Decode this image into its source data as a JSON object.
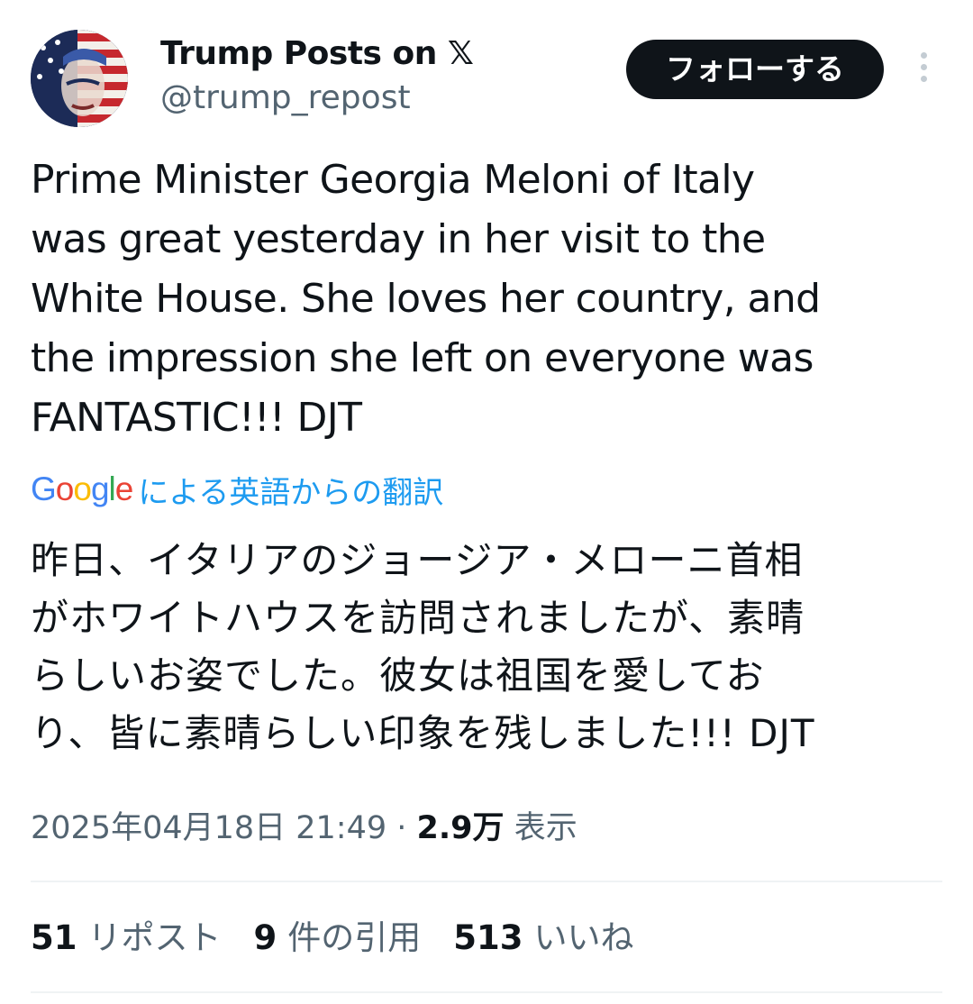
{
  "author": {
    "display_name": "Trump Posts on 𝕏",
    "handle": "@trump_repost",
    "avatar_icon": "avatar-portrait-flag"
  },
  "follow_button": {
    "label": "フォローする"
  },
  "more_icon": "more-vertical-icon",
  "tweet": {
    "text": "Prime Minister Georgia Meloni of Italy\nwas great yesterday in her visit to the\nWhite House. She loves her country, and\nthe impression she left on everyone was\nFANTASTIC!!! DJT",
    "translation_label": "による英語からの翻訳",
    "translated_text": "昨日、イタリアのジョージア・メローニ首相\nがホワイトハウスを訪問されましたが、素晴\nらしいお姿でした。彼女は祖国を愛してお\nり、皆に素晴らしい印象を残しました!!! DJT"
  },
  "meta": {
    "timestamp": "2025年04月18日 21:49",
    "separator": " · ",
    "views_count": "2.9万",
    "views_label": "表示"
  },
  "stats": {
    "reposts_count": "51",
    "reposts_label": "リポスト",
    "quotes_count": "9",
    "quotes_label": "件の引用",
    "likes_count": "513",
    "likes_label": "いいね"
  },
  "colors": {
    "text_primary": "#0f1419",
    "text_secondary": "#536471",
    "link_blue": "#1d9bf0",
    "divider": "#eff3f4",
    "follow_bg": "#0f1419"
  }
}
